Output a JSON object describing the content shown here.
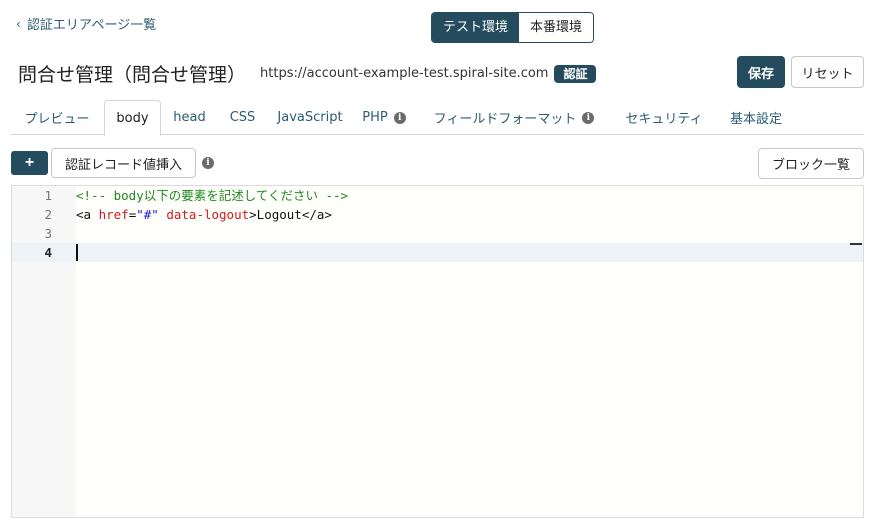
{
  "nav": {
    "back_label": "認証エリアページ一覧"
  },
  "env_toggle": {
    "test_label": "テスト環境",
    "prod_label": "本番環境",
    "selected": "テスト環境"
  },
  "header": {
    "title": "問合せ管理（問合せ管理）",
    "url": "https://account-example-test.spiral-site.com",
    "badge": "認証"
  },
  "actions": {
    "save_label": "保存",
    "reset_label": "リセット"
  },
  "tabs": [
    {
      "label": "プレビュー",
      "active": false,
      "info": false
    },
    {
      "label": "body",
      "active": true,
      "info": false
    },
    {
      "label": "head",
      "active": false,
      "info": false
    },
    {
      "label": "CSS",
      "active": false,
      "info": false
    },
    {
      "label": "JavaScript",
      "active": false,
      "info": false
    },
    {
      "label": "PHP",
      "active": false,
      "info": true
    },
    {
      "label": "フィールドフォーマット",
      "active": false,
      "info": true
    },
    {
      "label": "セキュリティ",
      "active": false,
      "info": false
    },
    {
      "label": "基本設定",
      "active": false,
      "info": false
    }
  ],
  "toolbar": {
    "add_label": "+",
    "insert_label": "認証レコード値挿入",
    "info_icon": "i",
    "block_list_label": "ブロック一覧"
  },
  "editor": {
    "current_line": 4,
    "lines": [
      {
        "number": "1",
        "comment": "<!-- body以下の要素を記述してください -->"
      },
      {
        "number": "2",
        "tag_open": "<a",
        "attr1": "href",
        "eq": "=",
        "str1": "\"#\"",
        "attr2": "data-logout",
        "tag_close": ">Logout</a>"
      },
      {
        "number": "3"
      },
      {
        "number": "4"
      }
    ]
  },
  "colors": {
    "accent": "#244c5e",
    "link": "#2a5d74",
    "comment": "#1e8a1e",
    "attribute": "#d11a1a",
    "string": "#1a1ad1"
  }
}
